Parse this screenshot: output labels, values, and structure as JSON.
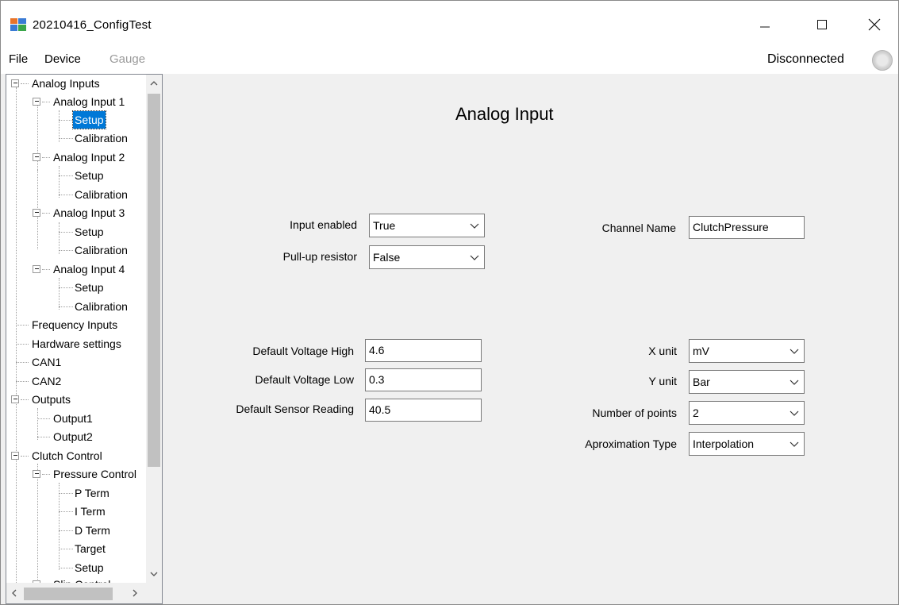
{
  "window": {
    "title": "20210416_ConfigTest",
    "icons": {
      "app": "app-window-icon",
      "minimize": "minimize-icon",
      "maximize": "maximize-icon",
      "close": "close-icon"
    }
  },
  "menu": {
    "file": "File",
    "device": "Device",
    "gauge": "Gauge",
    "status": "Disconnected",
    "status_color": "#d6d6d6"
  },
  "tree": {
    "accent": "#0078d7",
    "items": [
      {
        "label": "Analog Inputs"
      },
      {
        "label": "Analog Input 1"
      },
      {
        "label": "Setup"
      },
      {
        "label": "Calibration"
      },
      {
        "label": "Analog Input 2"
      },
      {
        "label": "Setup"
      },
      {
        "label": "Calibration"
      },
      {
        "label": "Analog Input 3"
      },
      {
        "label": "Setup"
      },
      {
        "label": "Calibration"
      },
      {
        "label": "Analog Input 4"
      },
      {
        "label": "Setup"
      },
      {
        "label": "Calibration"
      },
      {
        "label": "Frequency Inputs"
      },
      {
        "label": "Hardware settings"
      },
      {
        "label": "CAN1"
      },
      {
        "label": "CAN2"
      },
      {
        "label": "Outputs"
      },
      {
        "label": "Output1"
      },
      {
        "label": "Output2"
      },
      {
        "label": "Clutch Control"
      },
      {
        "label": "Pressure Control"
      },
      {
        "label": "P Term"
      },
      {
        "label": "I Term"
      },
      {
        "label": "D Term"
      },
      {
        "label": "Target"
      },
      {
        "label": "Setup"
      },
      {
        "label": "Slip Control"
      }
    ]
  },
  "form": {
    "title": "Analog Input",
    "input_enabled": {
      "label": "Input enabled",
      "value": "True"
    },
    "pullup": {
      "label": "Pull-up resistor",
      "value": "False"
    },
    "channel_name": {
      "label": "Channel Name",
      "value": "ClutchPressure"
    },
    "voltage_high": {
      "label": "Default Voltage High",
      "value": "4.6"
    },
    "voltage_low": {
      "label": "Default Voltage Low",
      "value": "0.3"
    },
    "sensor_reading": {
      "label": "Default Sensor Reading",
      "value": "40.5"
    },
    "x_unit": {
      "label": "X unit",
      "value": "mV"
    },
    "y_unit": {
      "label": "Y unit",
      "value": "Bar"
    },
    "points": {
      "label": "Number of points",
      "value": "2"
    },
    "approx": {
      "label": "Aproximation Type",
      "value": "Interpolation"
    }
  }
}
